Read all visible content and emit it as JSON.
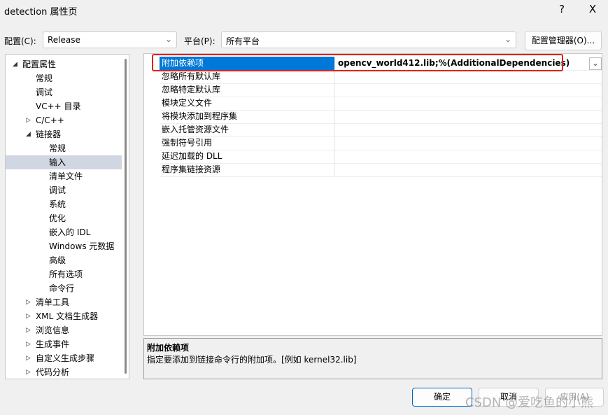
{
  "window": {
    "title": "detection 属性页",
    "help": "?",
    "close": "X"
  },
  "toolbar": {
    "config_label": "配置(C):",
    "config_value": "Release",
    "platform_label": "平台(P):",
    "platform_value": "所有平台",
    "config_manager": "配置管理器(O)..."
  },
  "tree": [
    {
      "label": "配置属性",
      "level": 0,
      "arrow": "expanded"
    },
    {
      "label": "常规",
      "level": 1
    },
    {
      "label": "调试",
      "level": 1
    },
    {
      "label": "VC++ 目录",
      "level": 1
    },
    {
      "label": "C/C++",
      "level": 1,
      "arrow": "collapsed"
    },
    {
      "label": "链接器",
      "level": 1,
      "arrow": "expanded"
    },
    {
      "label": "常规",
      "level": 2
    },
    {
      "label": "输入",
      "level": 2,
      "selected": true
    },
    {
      "label": "清单文件",
      "level": 2
    },
    {
      "label": "调试",
      "level": 2
    },
    {
      "label": "系统",
      "level": 2
    },
    {
      "label": "优化",
      "level": 2
    },
    {
      "label": "嵌入的 IDL",
      "level": 2
    },
    {
      "label": "Windows 元数据",
      "level": 2
    },
    {
      "label": "高级",
      "level": 2
    },
    {
      "label": "所有选项",
      "level": 2
    },
    {
      "label": "命令行",
      "level": 2
    },
    {
      "label": "清单工具",
      "level": 1,
      "arrow": "collapsed"
    },
    {
      "label": "XML 文档生成器",
      "level": 1,
      "arrow": "collapsed"
    },
    {
      "label": "浏览信息",
      "level": 1,
      "arrow": "collapsed"
    },
    {
      "label": "生成事件",
      "level": 1,
      "arrow": "collapsed"
    },
    {
      "label": "自定义生成步骤",
      "level": 1,
      "arrow": "collapsed"
    },
    {
      "label": "代码分析",
      "level": 1,
      "arrow": "collapsed"
    }
  ],
  "properties": [
    {
      "name": "附加依赖项",
      "value": "opencv_world412.lib;%(AdditionalDependencies)",
      "selected": true
    },
    {
      "name": "忽略所有默认库",
      "value": ""
    },
    {
      "name": "忽略特定默认库",
      "value": ""
    },
    {
      "name": "模块定义文件",
      "value": ""
    },
    {
      "name": "将模块添加到程序集",
      "value": ""
    },
    {
      "name": "嵌入托管资源文件",
      "value": ""
    },
    {
      "name": "强制符号引用",
      "value": ""
    },
    {
      "name": "延迟加载的 DLL",
      "value": ""
    },
    {
      "name": "程序集链接资源",
      "value": ""
    }
  ],
  "description": {
    "title": "附加依赖项",
    "text": "指定要添加到链接命令行的附加项。[例如 kernel32.lib]"
  },
  "buttons": {
    "ok": "确定",
    "cancel": "取消",
    "apply": "应用(A)"
  },
  "watermark": "CSDN @爱吃鱼的小熊",
  "colors": {
    "selection": "#0078d7",
    "highlight_box": "#e0201c"
  }
}
